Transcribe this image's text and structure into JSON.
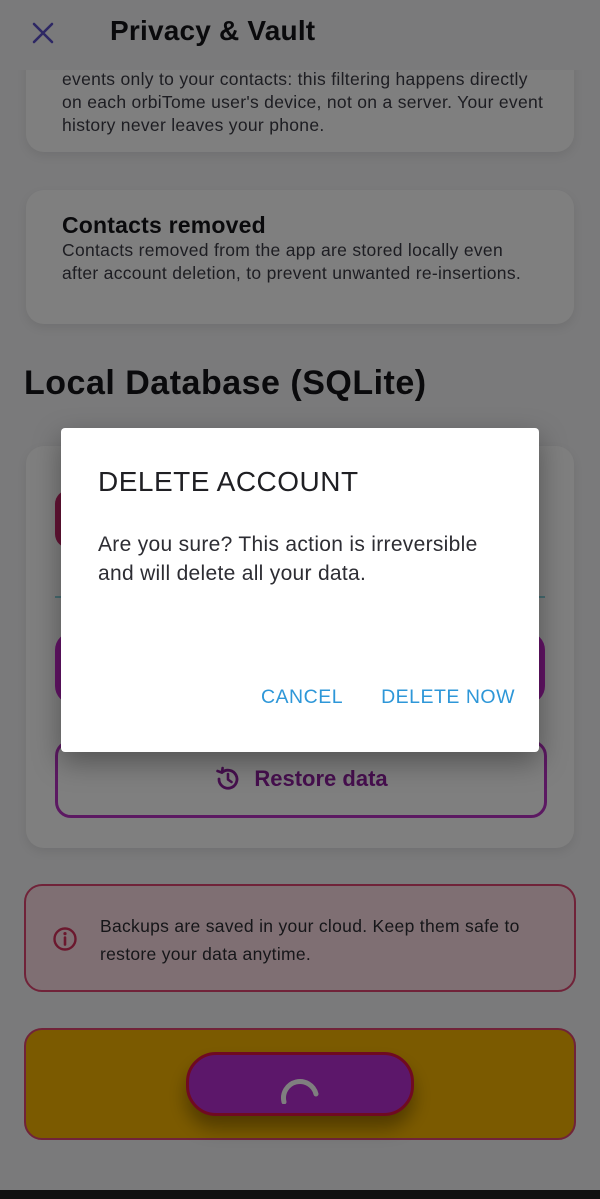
{
  "header": {
    "title": "Privacy & Vault"
  },
  "card_events": {
    "text": "events only to your contacts: this filtering happens directly on each orbiTome user's device, not on a server. Your event history never leaves your phone."
  },
  "card_contacts_removed": {
    "title": "Contacts removed",
    "text": "Contacts removed from the app are stored locally even after account deletion, to prevent unwanted re-insertions."
  },
  "section": {
    "title": "Local Database (SQLite)"
  },
  "database": {
    "restore_label": "Restore data"
  },
  "info_banner": {
    "text": "Backups are saved in your cloud. Keep them safe to restore your data anytime."
  },
  "dialog": {
    "title": "DELETE ACCOUNT",
    "message": "Are you sure? This action is irreversible and will delete all your data.",
    "cancel_label": "CANCEL",
    "confirm_label": "DELETE NOW"
  },
  "colors": {
    "accent_purple": "#b932c5",
    "danger_pink": "#e04772",
    "warning_yellow": "#f7b500",
    "dialog_button": "#2e97d8"
  },
  "icons": {
    "close": "close-icon",
    "restore": "history-icon",
    "info": "info-icon",
    "loading": "spinner-icon"
  }
}
